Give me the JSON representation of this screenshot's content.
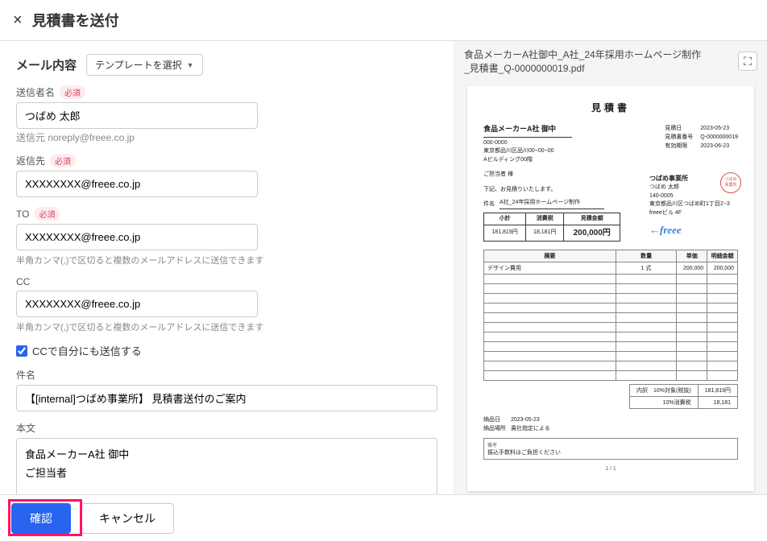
{
  "header": {
    "title": "見積書を送付"
  },
  "mail": {
    "section_title": "メール内容",
    "template_select": "テンプレートを選択",
    "sender_label": "送信者名",
    "required": "必須",
    "sender_value": "つばめ 太郎",
    "from_label": "送信元",
    "from_value": "noreply@freee.co.jp",
    "reply_label": "返信先",
    "reply_value": "XXXXXXXX@freee.co.jp",
    "to_label": "TO",
    "to_value": "XXXXXXXX@freee.co.jp",
    "to_help": "半角カンマ(,)で区切ると複数のメールアドレスに送信できます",
    "cc_label": "CC",
    "cc_value": "XXXXXXXX@freee.co.jp",
    "cc_help": "半角カンマ(,)で区切ると複数のメールアドレスに送信できます",
    "cc_self": "CCで自分にも送信する",
    "subject_label": "件名",
    "subject_value": "【[internal]つばめ事業所】 見積書送付のご案内",
    "body_label": "本文",
    "body_value": "食品メーカーA社 御中\nご担当者\n\nいつも大変お世話になっております。\n[internal]つばめ事業所でございます。\n\n平素は弊社に格別のお引き立てを賜り、誠にありがとうございます。"
  },
  "footer": {
    "confirm": "確認",
    "cancel": "キャンセル"
  },
  "preview": {
    "filename": "食品メーカーA社御中_A社_24年採用ホームページ制作_見積書_Q-0000000019.pdf"
  },
  "pdf": {
    "doc_title": "見積書",
    "client_name": "食品メーカーA社 御中",
    "client_postal": "000-0000",
    "client_addr": "東京都品川区品川00−00−00",
    "client_bldg": "Aビルディング00階",
    "meta_date_label": "見積日",
    "meta_date": "2023-05-23",
    "meta_num_label": "見積書番号",
    "meta_num": "Q-0000000019",
    "meta_valid_label": "有効期限",
    "meta_valid": "2023-06-23",
    "contact": "ご担当者 様",
    "lead": "下記、お見積りいたします。",
    "subject_label": "件名",
    "subject": "A社_24年採用ホームページ制作",
    "company_name": "つばめ事業所",
    "company_person": "つばめ 太郎",
    "company_postal": "140-0005",
    "company_addr": "東京都品川区つばめ町1丁目2−3",
    "company_bldg": "freeeビル 4F",
    "freee": "freee",
    "amt_subtotal_label": "小計",
    "amt_subtotal": "181,819円",
    "amt_tax_label": "消費税",
    "amt_tax": "18,181円",
    "amt_total_label": "見積金額",
    "amt_total": "200,000円",
    "col_desc": "摘要",
    "col_qty": "数量",
    "col_price": "単価",
    "col_amount": "明細金額",
    "row1_desc": "デザイン費用",
    "row1_qty": "1 式",
    "row1_price": "200,000",
    "row1_amount": "200,000",
    "sum_tax_label": "内訳　10%対象(税抜)",
    "sum_tax_val": "181,819円",
    "sum_tax2_label": "10%消費税",
    "sum_tax2_val": "18,181",
    "note_delivery_label": "納品日",
    "note_delivery": "2023-05-23",
    "note_place_label": "納品場所",
    "note_place": "貴社指定による",
    "remark_label": "備考",
    "remark": "振込手数料はご負担ください",
    "page": "1 / 1"
  }
}
